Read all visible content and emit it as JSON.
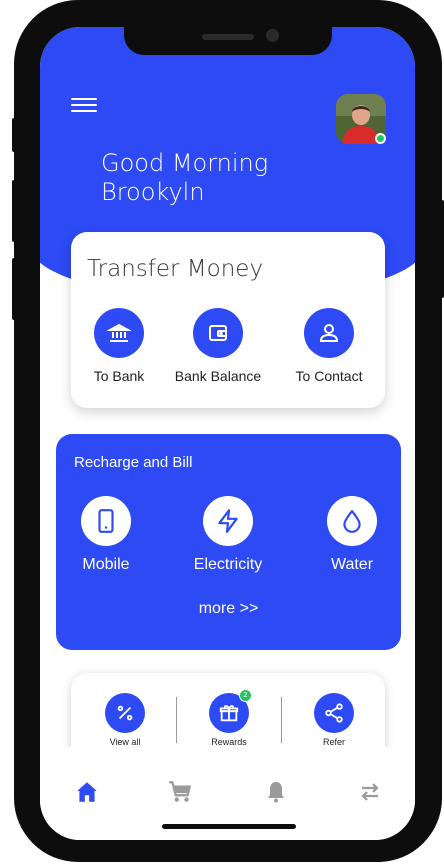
{
  "header": {
    "greeting_line1": "Good Morning",
    "greeting_line2": "Brookyln"
  },
  "transfer": {
    "title": "Transfer Money",
    "items": [
      {
        "label": "To Bank",
        "icon": "bank-icon"
      },
      {
        "label": "Bank Balance",
        "icon": "wallet-icon"
      },
      {
        "label": "To Contact",
        "icon": "contact-icon"
      }
    ]
  },
  "recharge": {
    "title": "Recharge and Bill",
    "items": [
      {
        "label": "Mobile",
        "icon": "mobile-icon"
      },
      {
        "label": "Electricity",
        "icon": "lightning-icon"
      },
      {
        "label": "Water",
        "icon": "water-drop-icon"
      }
    ],
    "more": "more >>"
  },
  "quick": {
    "items": [
      {
        "label": "View all",
        "icon": "percent-icon"
      },
      {
        "label": "Rewards",
        "icon": "gift-icon",
        "badge": "2"
      },
      {
        "label": "Refer",
        "icon": "share-icon"
      }
    ]
  },
  "nav": {
    "items": [
      "home-icon",
      "cart-icon",
      "bell-icon",
      "transfer-arrows-icon"
    ],
    "active": "home-icon"
  },
  "colors": {
    "primary": "#2d4af5",
    "online": "#22c55e",
    "nav_inactive": "#9a9a9a"
  }
}
